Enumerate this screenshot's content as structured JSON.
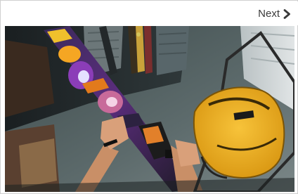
{
  "navigation": {
    "next_label": "Next",
    "next_icon": "chevron-right-icon"
  },
  "photo": {
    "subject_icon": "photo-snowboard-with-hands-and-yellow-backpack"
  },
  "colors": {
    "border": "#cfcfcf",
    "text": "#3a3a3a",
    "backpack_yellow": "#f2b31a"
  }
}
